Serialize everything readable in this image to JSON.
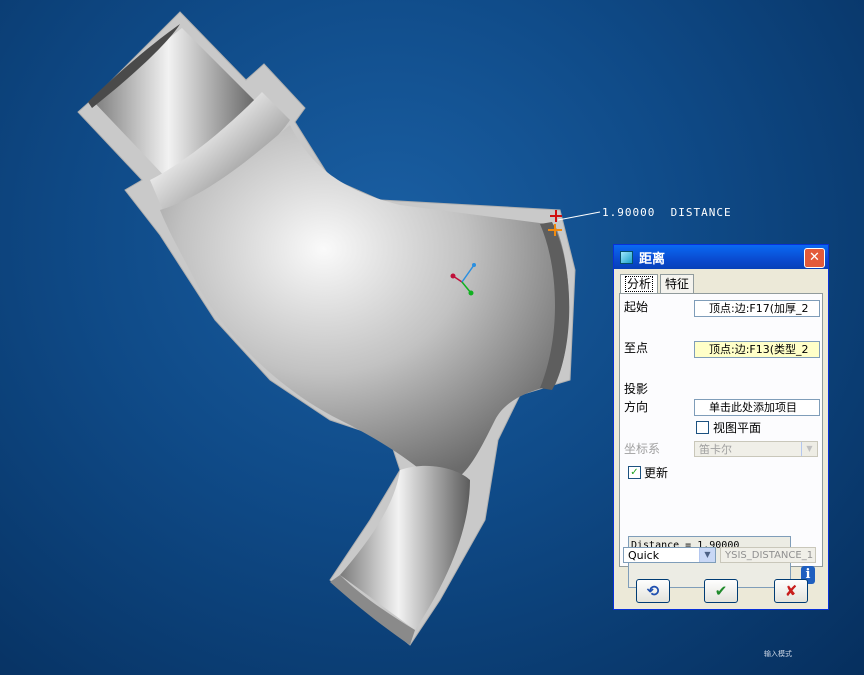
{
  "viewport": {
    "measurement_label": "1.90000  DISTANCE",
    "mode_label": "输入模式"
  },
  "dialog": {
    "title": "距离",
    "close": "✕",
    "tabs": [
      {
        "label": "分析",
        "active": true
      },
      {
        "label": "特征",
        "active": false
      }
    ],
    "from_label": "起始",
    "from_value": "顶点:边:F17(加厚_2",
    "to_label": "至点",
    "to_value": "顶点:边:F13(类型_2",
    "projection_label": "投影",
    "direction_label": "方向",
    "direction_value": "单击此处添加项目",
    "view_plane_label": "视图平面",
    "coord_label": "坐标系",
    "coord_value": "笛卡尔",
    "update_label": "更新",
    "result_text": "Distance = 1.90000",
    "quick_value": "Quick",
    "analysis_name": "YSIS_DISTANCE_1",
    "info_icon": "i",
    "repeat_icon": "⟲",
    "ok_icon": "✔",
    "cancel_icon": "✘"
  },
  "colors": {
    "background": "#0f4a87",
    "title_bar": "#0a4bd0",
    "ok_green": "#1f8a2b",
    "cancel_red": "#c81e1e"
  }
}
